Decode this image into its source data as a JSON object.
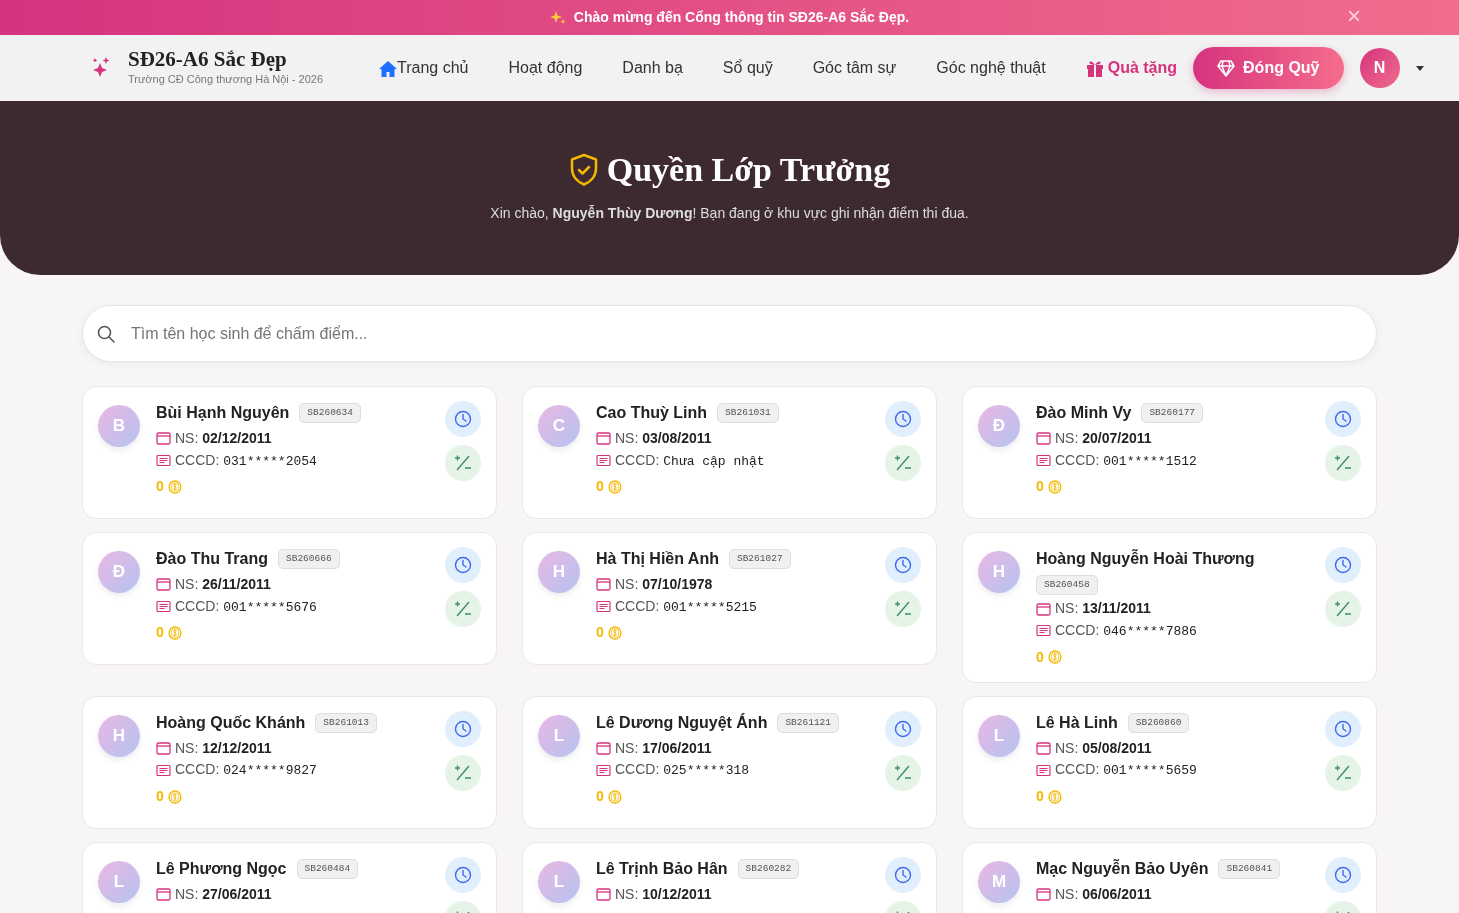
{
  "announcement": {
    "text": "Chào mừng đến Cổng thông tin **SĐ26-A6 Sắc Đẹp.**",
    "close": "×"
  },
  "brand": {
    "title": "SĐ26-A6 Sắc Đẹp",
    "subtitle": "Trường CĐ Công thương Hà Nội - 2026"
  },
  "nav": [
    {
      "label": "Trang chủ",
      "kind": "home"
    },
    {
      "label": "Hoạt động",
      "kind": "plain"
    },
    {
      "label": "Danh bạ",
      "kind": "plain"
    },
    {
      "label": "Sổ quỹ",
      "kind": "plain"
    },
    {
      "label": "Góc tâm sự",
      "kind": "plain"
    },
    {
      "label": "Góc nghệ thuật",
      "kind": "plain"
    },
    {
      "label": "Quà tặng",
      "kind": "gift"
    }
  ],
  "donate_button": "Đóng Quỹ",
  "user": {
    "initial": "N"
  },
  "hero": {
    "title": "Quyền Lớp Trưởng",
    "message": "Xin chào, **Nguyễn Thùy Dương**! Bạn đang ở khu vực ghi nhận điểm thi đua."
  },
  "search": {
    "placeholder": "Tìm tên học sinh để chấm điểm..."
  },
  "students": [
    {
      "initial": "B",
      "name": "Bùi Hạnh Nguyên",
      "code": "SB260634",
      "ns_label": "NS:",
      "ns": "02/12/2011",
      "cccd_label": "CCCD:",
      "cccd": "031*****2054",
      "points": "0"
    },
    {
      "initial": "C",
      "name": "Cao Thuỳ Linh",
      "code": "SB261031",
      "ns_label": "NS:",
      "ns": "03/08/2011",
      "cccd_label": "CCCD:",
      "cccd": "Chưa cập nhật",
      "points": "0"
    },
    {
      "initial": "Đ",
      "name": "Đào Minh Vy",
      "code": "SB260177",
      "ns_label": "NS:",
      "ns": "20/07/2011",
      "cccd_label": "CCCD:",
      "cccd": "001*****1512",
      "points": "0"
    },
    {
      "initial": "Đ",
      "name": "Đào Thu Trang",
      "code": "SB260666",
      "ns_label": "NS:",
      "ns": "26/11/2011",
      "cccd_label": "CCCD:",
      "cccd": "001*****5676",
      "points": "0"
    },
    {
      "initial": "H",
      "name": "Hà Thị Hiền Anh",
      "code": "SB261027",
      "ns_label": "NS:",
      "ns": "07/10/1978",
      "cccd_label": "CCCD:",
      "cccd": "001*****5215",
      "points": "0"
    },
    {
      "initial": "H",
      "name": "Hoàng Nguyễn Hoài Thương",
      "code": "SB260458",
      "ns_label": "NS:",
      "ns": "13/11/2011",
      "cccd_label": "CCCD:",
      "cccd": "046*****7886",
      "points": "0"
    },
    {
      "initial": "H",
      "name": "Hoàng Quốc Khánh",
      "code": "SB261013",
      "ns_label": "NS:",
      "ns": "12/12/2011",
      "cccd_label": "CCCD:",
      "cccd": "024*****9827",
      "points": "0"
    },
    {
      "initial": "L",
      "name": "Lê Dương Nguyệt Ánh",
      "code": "SB261121",
      "ns_label": "NS:",
      "ns": "17/06/2011",
      "cccd_label": "CCCD:",
      "cccd": "025*****318",
      "points": "0"
    },
    {
      "initial": "L",
      "name": "Lê Hà Linh",
      "code": "SB260860",
      "ns_label": "NS:",
      "ns": "05/08/2011",
      "cccd_label": "CCCD:",
      "cccd": "001*****5659",
      "points": "0"
    },
    {
      "initial": "L",
      "name": "Lê Phương Ngọc",
      "code": "SB260484",
      "ns_label": "NS:",
      "ns": "27/06/2011"
    },
    {
      "initial": "L",
      "name": "Lê Trịnh Bảo Hân",
      "code": "SB260282",
      "ns_label": "NS:",
      "ns": "10/12/2011"
    },
    {
      "initial": "M",
      "name": "Mạc Nguyễn Bảo Uyên",
      "code": "SB260841",
      "ns_label": "NS:",
      "ns": "06/06/2011"
    }
  ]
}
